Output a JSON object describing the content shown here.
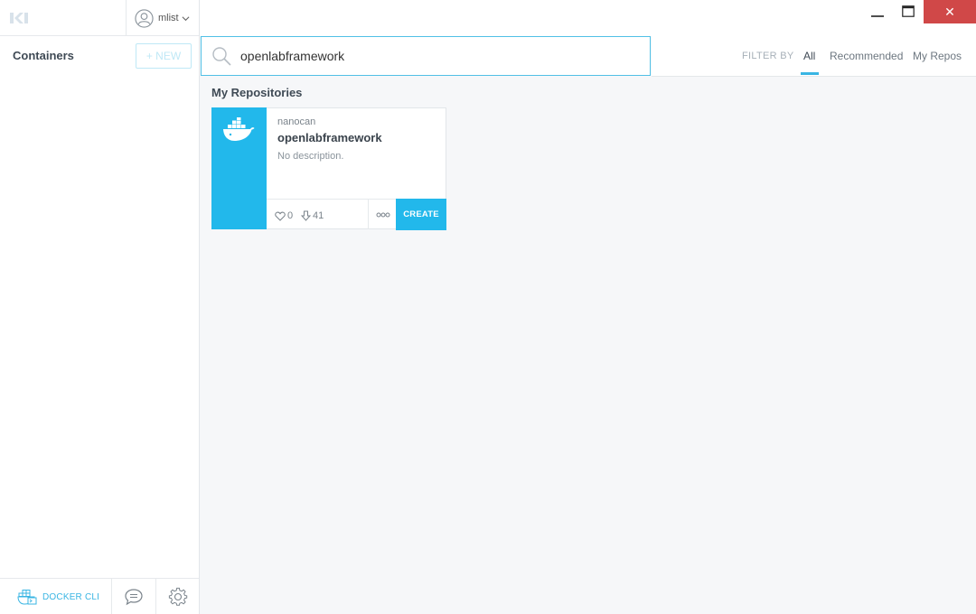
{
  "sidebar": {
    "logo_icon": "kitematic-logo-icon",
    "user": {
      "name": "mlist",
      "avatar_icon": "user-avatar-icon",
      "chevron_icon": "chevron-down-icon"
    },
    "containers_title": "Containers",
    "new_button": "+ NEW",
    "bottom": {
      "cli_label": "DOCKER CLI",
      "cli_icon": "docker-cli-icon",
      "chat_icon": "chat-icon",
      "settings_icon": "gear-icon"
    }
  },
  "window_controls": {
    "minimize_icon": "minimize-icon",
    "maximize_icon": "maximize-icon",
    "close_label": "✕"
  },
  "search": {
    "value": "openlabframework",
    "icon": "search-icon"
  },
  "filter": {
    "label": "FILTER BY",
    "tabs": [
      "All",
      "Recommended",
      "My Repos"
    ],
    "active": "All"
  },
  "section_title": "My Repositories",
  "repos": [
    {
      "owner": "nanocan",
      "name": "openlabframework",
      "description": "No description.",
      "stars": "0",
      "pulls": "41",
      "create_label": "CREATE",
      "icon": "docker-whale-icon"
    }
  ],
  "colors": {
    "accent": "#22b8eb",
    "close_red": "#d04848",
    "text_dark": "#3f4a55"
  }
}
